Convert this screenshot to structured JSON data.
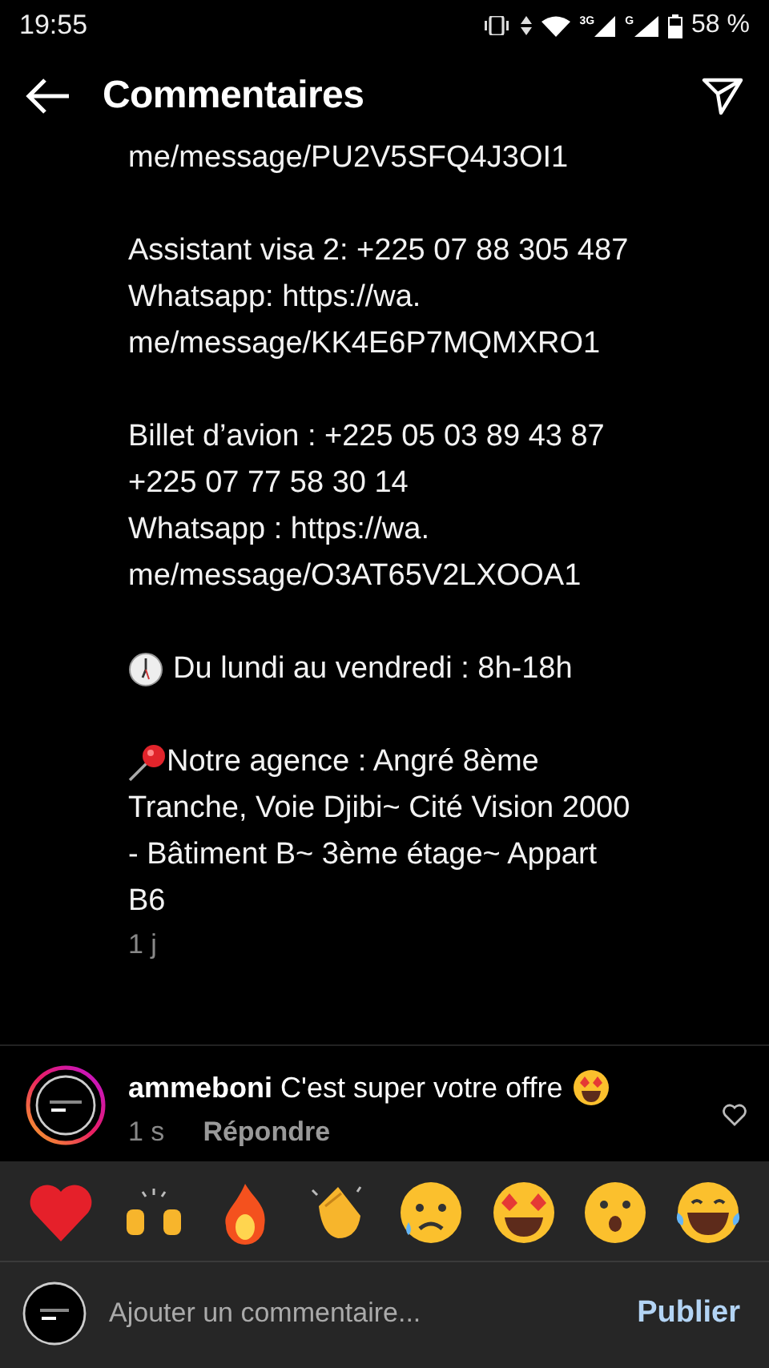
{
  "status_bar": {
    "time": "19:55",
    "network": "3G",
    "network_2": "G",
    "battery": "58 %"
  },
  "header": {
    "title": "Commentaires"
  },
  "caption": {
    "paragraphs": [
      {
        "kind": "text",
        "lines": [
          "me/message/PU2V5SFQ4J3OI1"
        ]
      },
      {
        "kind": "text",
        "lines": [
          "Assistant visa 2: +225 07 88 305 487",
          "Whatsapp: https://wa.",
          "me/message/KK4E6P7MQMXRO1"
        ]
      },
      {
        "kind": "text",
        "lines": [
          "Billet d’avion : +225 05 03 89 43 87",
          "+225 07 77 58 30 14",
          "Whatsapp : https://wa.",
          "me/message/O3AT65V2LXOOA1"
        ]
      },
      {
        "kind": "clock",
        "lines": [
          "Du lundi au vendredi : 8h-18h"
        ]
      },
      {
        "kind": "pin",
        "lines": [
          "Notre agence : Angré 8ème",
          "Tranche, Voie Djibi~ Cité Vision 2000",
          "- Bâtiment B~ 3ème étage~ Appart",
          "B6"
        ]
      }
    ],
    "age": "1 j"
  },
  "comments": [
    {
      "user": "ammeboni",
      "text": "C'est super votre offre",
      "age": "1 s",
      "reply": "Répondre",
      "liked": false
    }
  ],
  "composer": {
    "placeholder": "Ajouter un commentaire...",
    "submit": "Publier"
  }
}
